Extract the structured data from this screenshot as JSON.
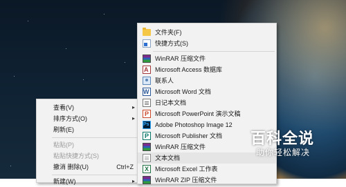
{
  "context_menu": {
    "items": [
      {
        "label": "查看(V)",
        "has_submenu": true
      },
      {
        "label": "排序方式(O)",
        "has_submenu": true
      },
      {
        "label": "刷新(E)"
      },
      {
        "label": "粘贴(P)",
        "disabled": true
      },
      {
        "label": "粘贴快捷方式(S)",
        "disabled": true
      },
      {
        "label": "撤消 删除(U)",
        "shortcut": "Ctrl+Z"
      },
      {
        "label": "新建(W)",
        "has_submenu": true
      }
    ]
  },
  "new_submenu": {
    "items": [
      {
        "label": "文件夹(F)",
        "icon": "folder-icon"
      },
      {
        "label": "快捷方式(S)",
        "icon": "shortcut-icon"
      },
      {
        "label": "WinRAR 压缩文件",
        "icon": "winrar-icon"
      },
      {
        "label": "Microsoft Access 数据库",
        "icon": "access-icon"
      },
      {
        "label": "联系人",
        "icon": "contact-icon"
      },
      {
        "label": "Microsoft Word 文档",
        "icon": "word-icon"
      },
      {
        "label": "日记本文档",
        "icon": "journal-icon"
      },
      {
        "label": "Microsoft PowerPoint 演示文稿",
        "icon": "powerpoint-icon"
      },
      {
        "label": "Adobe Photoshop Image 12",
        "icon": "photoshop-icon"
      },
      {
        "label": "Microsoft Publisher 文档",
        "icon": "publisher-icon"
      },
      {
        "label": "WinRAR 压缩文件",
        "icon": "winrar-icon"
      },
      {
        "label": "文本文档",
        "icon": "text-document-icon",
        "highlighted": true
      },
      {
        "label": "Microsoft Excel 工作表",
        "icon": "excel-icon"
      },
      {
        "label": "WinRAR ZIP 压缩文件",
        "icon": "winrar-zip-icon"
      }
    ]
  },
  "watermark": {
    "title": "百科全说",
    "subtitle": "助你轻松解决"
  },
  "colors": {
    "menu_bg": "#f2f2f2",
    "menu_border": "#cfcfcf",
    "highlight": "#e5e5e5",
    "disabled_text": "#9a9a9a"
  }
}
